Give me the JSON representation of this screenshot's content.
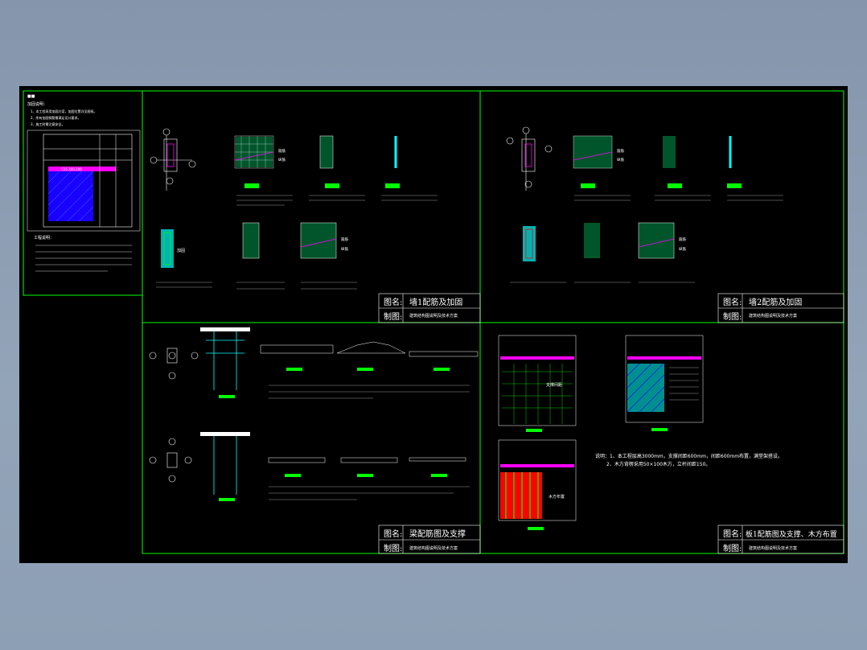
{
  "sheet": {
    "top_left_panel": {
      "title_label": "图名:",
      "title": "墙1配筋及加固",
      "drawing_label": "制图:",
      "note": "建筑结构图说明及技术方案",
      "sub_note": "绘制图"
    },
    "top_right_panel": {
      "title_label": "图名:",
      "title": "墙2配筋及加固",
      "drawing_label": "制图:",
      "note": "建筑结构图说明及技术方案",
      "sub_note": "绘制图"
    },
    "bottom_left_panel": {
      "title_label": "图名:",
      "title": "梁配筋图及支撑",
      "drawing_label": "制图:",
      "note": "建筑结构图说明及技术方案",
      "sub_note": "绘制图"
    },
    "bottom_right_panel": {
      "title_label": "图名:",
      "title": "板1配筋图及支撑、木方布置",
      "drawing_label": "制图:",
      "note": "建筑结构图说明及技术方案",
      "sub_note": "绘制图",
      "remark_1": "说明：1、本工程层高3000mm，支撑间距600mm，间距600mm布置，满堂架搭设。",
      "remark_2": "2、木方背楞采用50×100木方，立杆间距150。",
      "label_support": "支撑间距",
      "label_wood": "木方布置"
    },
    "left_column": {
      "header": "加固说明：",
      "note_1": "1、本工程采用加固方案，加固位置详见图纸。",
      "note_2": "2、所有加固钢筋需满足设计要求。",
      "note_3": "3、施工时需注意安全。",
      "section_label": "C15 300.200",
      "engineering_notes": "工程说明："
    },
    "labels": {
      "section_a": "加固",
      "section_b": "箍筋",
      "section_c": "纵筋",
      "note_small": "墙体",
      "title_small": "剖面图"
    }
  },
  "colors": {
    "frame": "#00ff00",
    "line": "#ffffff",
    "section": "#00ffff",
    "magenta": "#ff00ff",
    "red": "#ff0000",
    "blue": "#1a00ff",
    "yellow": "#ffff00"
  }
}
